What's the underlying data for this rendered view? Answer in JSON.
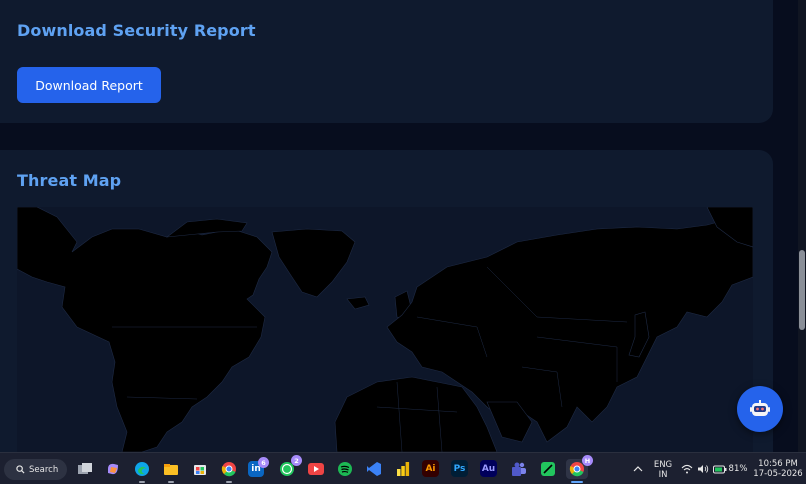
{
  "download_section": {
    "title": "Download Security Report",
    "button_label": "Download Report"
  },
  "threat_section": {
    "title": "Threat Map"
  },
  "taskbar": {
    "search_label": "Search",
    "apps": [
      {
        "name": "task-view",
        "label": ""
      },
      {
        "name": "copilot",
        "label": ""
      },
      {
        "name": "edge",
        "label": ""
      },
      {
        "name": "file-explorer",
        "label": ""
      },
      {
        "name": "microsoft-store",
        "label": ""
      },
      {
        "name": "chrome",
        "label": ""
      },
      {
        "name": "linkedin",
        "label": "in",
        "badge": "6"
      },
      {
        "name": "whatsapp",
        "label": "",
        "badge": "2"
      },
      {
        "name": "youtube",
        "label": ""
      },
      {
        "name": "spotify",
        "label": ""
      },
      {
        "name": "vscode",
        "label": ""
      },
      {
        "name": "power-bi",
        "label": ""
      },
      {
        "name": "illustrator",
        "label": "Ai"
      },
      {
        "name": "photoshop",
        "label": "Ps"
      },
      {
        "name": "audition",
        "label": "Au"
      },
      {
        "name": "teams",
        "label": ""
      },
      {
        "name": "green-app",
        "label": ""
      },
      {
        "name": "chrome-profile",
        "label": "",
        "badge": "H"
      }
    ],
    "tray": {
      "language_line1": "ENG",
      "language_line2": "IN",
      "battery": "81%",
      "time": "10:56 PM",
      "date": "17-05-2026"
    }
  },
  "colors": {
    "page_bg": "#070d1e",
    "card_bg": "#0f1a2e",
    "accent": "#2563eb",
    "title": "#5fa2f2",
    "land": "#000000"
  }
}
